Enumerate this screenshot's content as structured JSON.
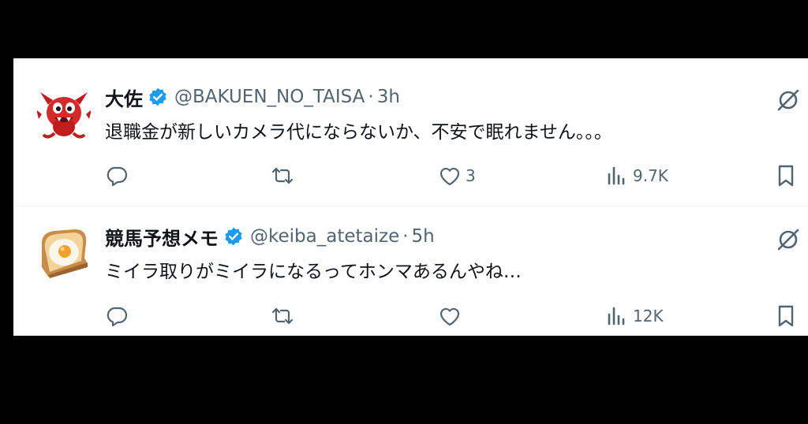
{
  "tweets": [
    {
      "name": "大佐",
      "handle": "@BAKUEN_NO_TAISA",
      "separator": "·",
      "time": "3h",
      "text": "退職金が新しいカメラ代にならないか、不安で眠れません。。。",
      "replies": "",
      "retweets": "",
      "likes": "3",
      "views": "9.7K",
      "avatar_icon": "red-devil-icon"
    },
    {
      "name": "競馬予想メモ",
      "handle": "@keiba_atetaize",
      "separator": "·",
      "time": "5h",
      "text": "ミイラ取りがミイラになるってホンマあるんやね…",
      "replies": "",
      "retweets": "",
      "likes": "",
      "views": "12K",
      "avatar_icon": "egg-toast-icon"
    }
  ],
  "colors": {
    "verified": "#1d9bf0",
    "text": "#0f1419",
    "secondary": "#536471",
    "background": "#ffffff",
    "frame": "#000000"
  }
}
